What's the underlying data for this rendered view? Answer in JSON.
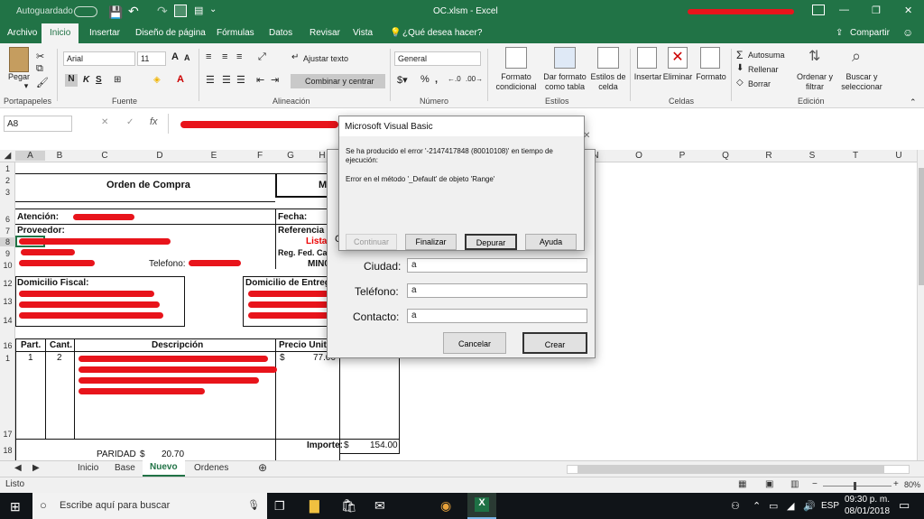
{
  "titlebar": {
    "autosave_label": "Autoguardado",
    "autosave_state": "●",
    "title": "OC.xlsm - Excel",
    "user_name": "",
    "btn_min": "—",
    "btn_max": "❐",
    "btn_close": "✕"
  },
  "ribbon_tabs": [
    "Archivo",
    "Inicio",
    "Insertar",
    "Diseño de página",
    "Fórmulas",
    "Datos",
    "Revisar",
    "Vista"
  ],
  "tell_me": "¿Qué desea hacer?",
  "share": "Compartir",
  "ribbon": {
    "paste": "Pegar",
    "font_name": "Arial",
    "font_size": "11",
    "wrap_text": "Ajustar texto",
    "merge_center": "Combinar y centrar",
    "number_format": "General",
    "cond_format": "Formato condicional",
    "format_table": "Dar formato como tabla",
    "cell_styles": "Estilos de celda",
    "insert": "Insertar",
    "delete": "Eliminar",
    "format": "Formato",
    "autosum": "Autosuma",
    "fill": "Rellenar",
    "clear": "Borrar",
    "sort_filter": "Ordenar y filtrar",
    "find_select": "Buscar y seleccionar",
    "groups": [
      "Portapapeles",
      "Fuente",
      "Alineación",
      "Número",
      "Estilos",
      "Celdas",
      "Edición"
    ]
  },
  "formula_bar": {
    "name_box": "A8",
    "fx": "fx",
    "content": ""
  },
  "columns": [
    "A",
    "B",
    "C",
    "D",
    "E",
    "F",
    "G",
    "H",
    "I",
    "J",
    "K",
    "L",
    "M",
    "N",
    "O",
    "P",
    "Q",
    "R",
    "S",
    "T",
    "U"
  ],
  "rows": [
    "1",
    "2",
    "3",
    "6",
    "7",
    "8",
    "9",
    "10",
    "12",
    "13",
    "14",
    "16",
    "1",
    "17",
    "18"
  ],
  "sheet": {
    "title": "Orden de Compra",
    "me": "ME",
    "atencion": "Atención:",
    "fecha": "Fecha:",
    "proveedor": "Proveedor:",
    "referencia": "Referencia",
    "lista": "Lista",
    "reg_fed": "Reg. Fed. Cau",
    "min": "MIN0",
    "telefono": "Telefono:",
    "dom_fiscal": "Domicilio Fiscal:",
    "dom_entrega": "Domicilio de Entrega:",
    "part": "Part.",
    "cant": "Cant.",
    "descripcion": "Descripción",
    "precio": "Precio Unitar",
    "row1_part": "1",
    "row1_cant": "2",
    "row1_dollar": "$",
    "row1_price": "77.00",
    "paridad_label": "PARIDAD",
    "paridad_dollar": "$",
    "paridad_value": "20.70",
    "importe_label": "Importe:",
    "importe_dollar": "$",
    "importe_value": "154.00"
  },
  "sheet_tabs": [
    "Inicio",
    "Base",
    "Nuevo",
    "Ordenes"
  ],
  "status": {
    "ready": "Listo",
    "zoom": "80%"
  },
  "form": {
    "ciudad_label": "Ciudad:",
    "ciudad_value": "a",
    "telefono_label": "Teléfono:",
    "telefono_value": "a",
    "contacto_label": "Contacto:",
    "contacto_value": "a",
    "cancel": "Cancelar",
    "create": "Crear",
    "partial_c": "C"
  },
  "vb_dialog": {
    "title": "Microsoft Visual Basic",
    "message1": "Se ha producido el error '-2147417848 (80010108)' en tiempo de ejecución:",
    "message2": "Error en el método '_Default' de objeto 'Range'",
    "btn_continue": "Continuar",
    "btn_end": "Finalizar",
    "btn_debug": "Depurar",
    "btn_help": "Ayuda"
  },
  "taskbar": {
    "search_placeholder": "Escribe aquí para buscar",
    "lang": "ESP",
    "time": "09:30 p. m.",
    "date": "08/01/2018"
  },
  "colors": {
    "excel_green": "#217346",
    "redaction": "#e8141b"
  }
}
